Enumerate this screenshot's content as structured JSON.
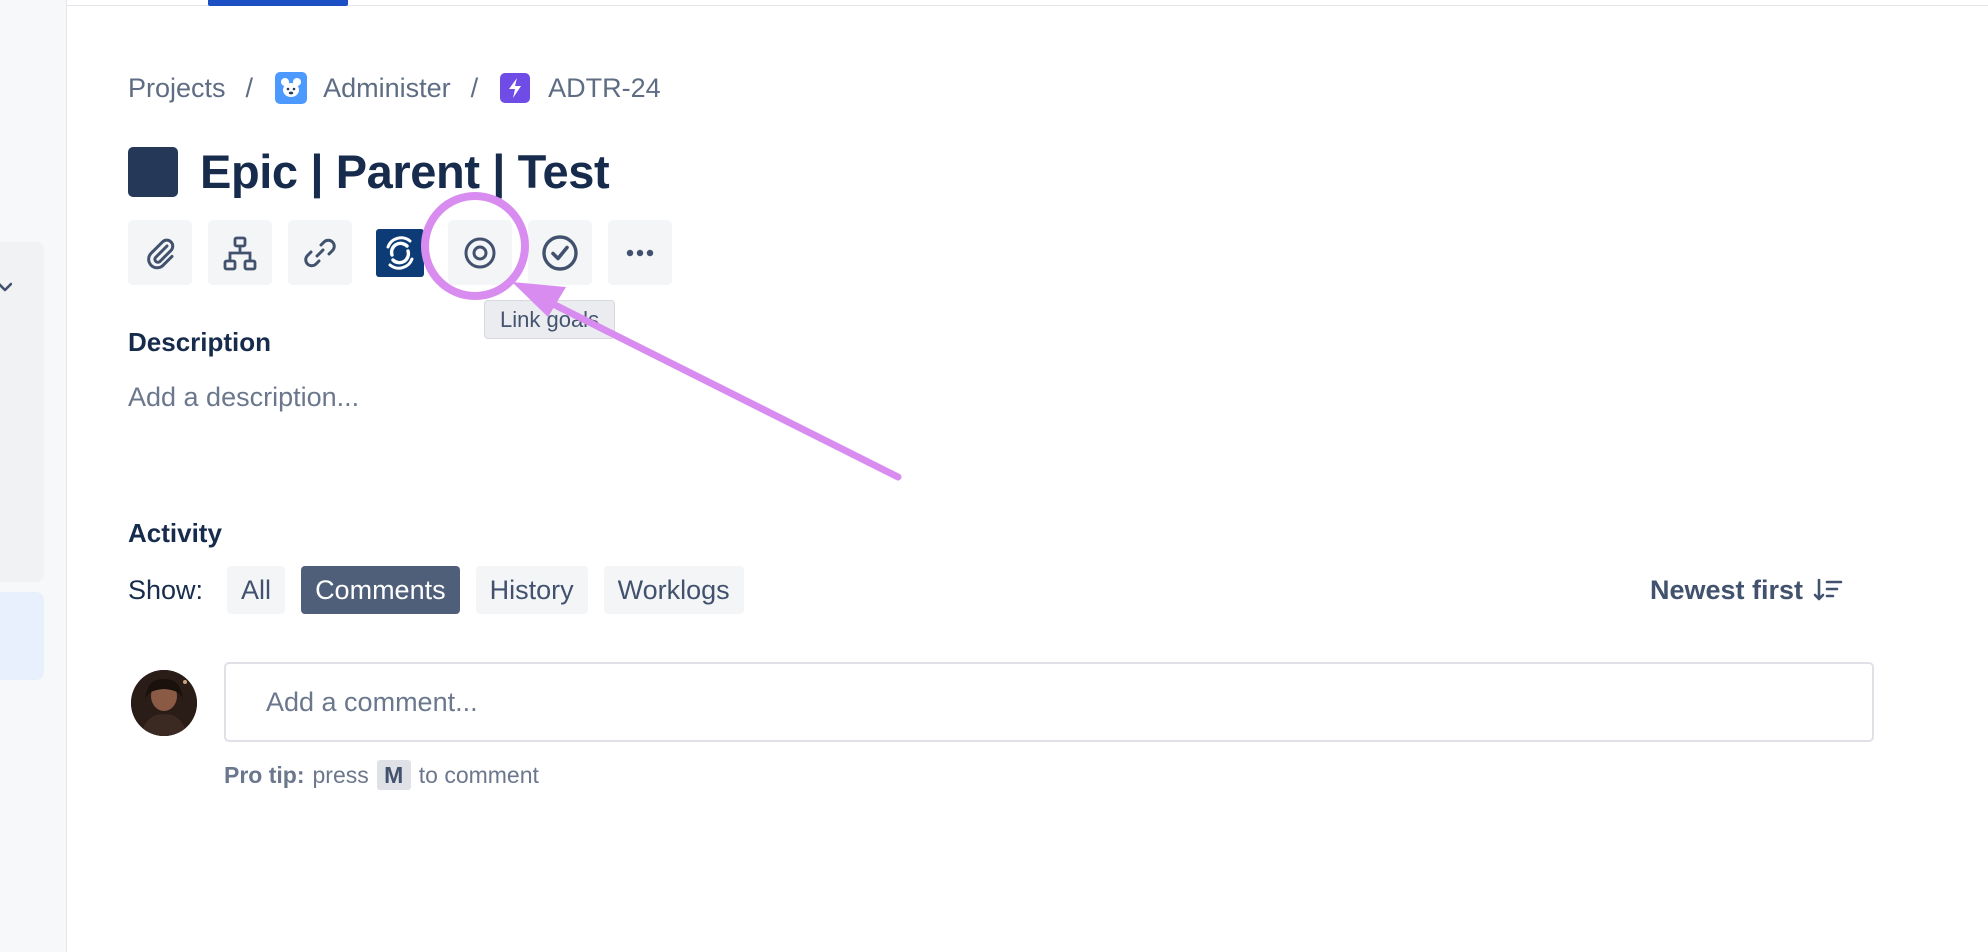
{
  "breadcrumb": {
    "projects": "Projects",
    "separator": "/",
    "project_name": "Administer",
    "issue_key": "ADTR-24"
  },
  "issue": {
    "title": "Epic | Parent | Test",
    "type_color": "#253858"
  },
  "toolbar": {
    "buttons": [
      {
        "icon": "paperclip-icon"
      },
      {
        "icon": "hierarchy-icon"
      },
      {
        "icon": "link-icon"
      },
      {
        "icon": "app-integration-icon"
      },
      {
        "icon": "target-icon"
      },
      {
        "icon": "check-circle-icon"
      },
      {
        "icon": "more-icon"
      }
    ],
    "tooltip": "Link goals"
  },
  "description": {
    "heading": "Description",
    "placeholder": "Add a description..."
  },
  "activity": {
    "heading": "Activity",
    "show_label": "Show:",
    "filters": [
      "All",
      "Comments",
      "History",
      "Worklogs"
    ],
    "selected_filter": "Comments",
    "sort_label": "Newest first"
  },
  "comment": {
    "placeholder": "Add a comment...",
    "pro_tip_label": "Pro tip:",
    "pro_tip_before": "press",
    "pro_tip_key": "M",
    "pro_tip_after": "to comment"
  },
  "colors": {
    "accent": "#1d4fc4",
    "annotation": "#d98cf0",
    "selected_filter_bg": "#505f79"
  }
}
